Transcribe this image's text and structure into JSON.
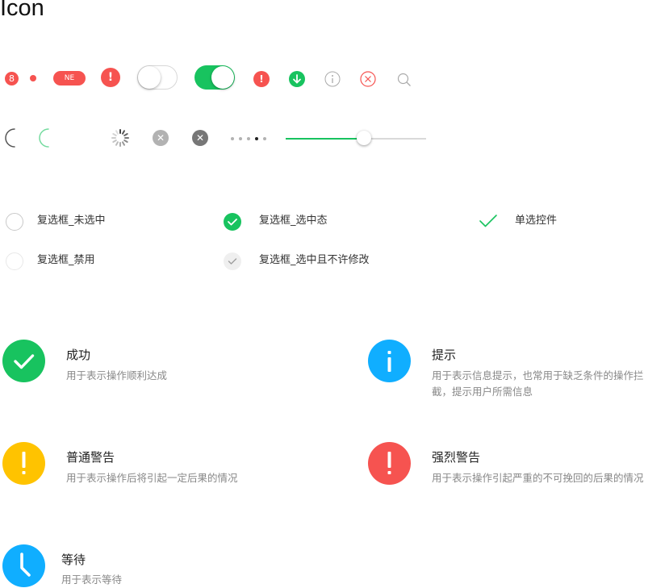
{
  "page": {
    "title": "Icon"
  },
  "row1": {
    "badge_count": "8",
    "pill_label": "NE",
    "toggle_off_on": false,
    "toggle_on_on": true
  },
  "row2": {
    "pager": {
      "count": 5,
      "active_index": 3
    },
    "slider": {
      "value_fraction": 0.56
    }
  },
  "checkboxes": {
    "unchecked_label": "复选框_未选中",
    "disabled_label": "复选框_禁用",
    "checked_label": "复选框_选中态",
    "checked_locked_label": "复选框_选中且不许修改",
    "radio_label": "单选控件"
  },
  "status": {
    "success": {
      "title": "成功",
      "desc": "用于表示操作顺利达成",
      "color": "#18c35f"
    },
    "info": {
      "title": "提示",
      "desc_line1": "用于表示信息提示，也常用于缺乏条件的操作拦",
      "desc_line2": "截，提示用户所需信息",
      "color": "#10aeff"
    },
    "warn": {
      "title": "普通警告",
      "desc": "用于表示操作后将引起一定后果的情况",
      "color": "#ffc300"
    },
    "danger": {
      "title": "强烈警告",
      "desc": "用于表示操作引起严重的不可挽回的后果的情况",
      "color": "#f65350"
    },
    "waiting": {
      "title": "等待",
      "desc": "用于表示等待",
      "color": "#10aeff"
    }
  },
  "colors": {
    "green": "#18c35f",
    "red": "#f65350",
    "blue": "#10aeff",
    "yellow": "#ffc300"
  }
}
